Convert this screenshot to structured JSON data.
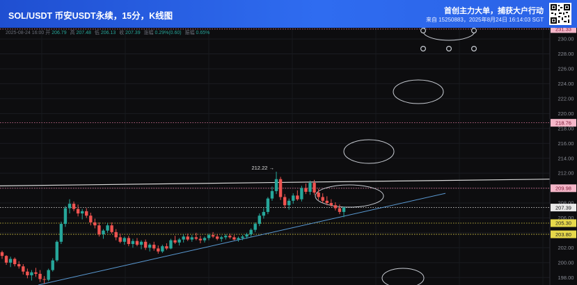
{
  "header": {
    "title": "SOL/USDT 币安USDT永续，15分，K线图",
    "slogan": "首创主力大单，捕获大户行动",
    "meta": "来自 15250883，2025年8月24日 16:14:03 SGT"
  },
  "ohlc_bar": {
    "datetime": "2025-08-24 16:00",
    "open_label": "开",
    "open": "206.79",
    "high_label": "高",
    "high": "207.48",
    "low_label": "低",
    "low": "206.13",
    "close_label": "收",
    "close": "207.39",
    "change_label": "涨幅",
    "change": "0.29%(0.60)",
    "amplitude_label": "振幅",
    "amplitude": "0.65%"
  },
  "colors": {
    "up": "#26a69a",
    "down": "#ef5350",
    "trendline": "#5b9bd5",
    "resistance": "#d9d9d9",
    "support": "#e6d84a",
    "alert": "#e57ca0",
    "current": "#cfcfcf"
  },
  "chart_data": {
    "type": "candlestick",
    "symbol": "SOL/USDT",
    "interval": "15m",
    "y_axis": {
      "min": 197,
      "max": 231.5,
      "position": "right",
      "ticks": [
        198.0,
        200.0,
        202.0,
        204.0,
        206.0,
        208.0,
        210.0,
        212.0,
        214.0,
        216.0,
        218.0,
        220.0,
        222.0,
        224.0,
        226.0,
        228.0,
        230.0
      ]
    },
    "grid": true,
    "price_tags": [
      {
        "label": "231.33",
        "value": 231.33,
        "style": "alert"
      },
      {
        "label": "218.76",
        "value": 218.76,
        "style": "alert"
      },
      {
        "label": "209.98",
        "value": 209.98,
        "style": "alert"
      },
      {
        "label": "207.39",
        "value": 207.39,
        "style": "current"
      },
      {
        "label": "205.30",
        "value": 205.3,
        "style": "support"
      },
      {
        "label": "203.80",
        "value": 203.8,
        "style": "support"
      }
    ],
    "annotation": {
      "label": "212.22 →",
      "value": 212.22
    },
    "candles": [
      [
        201.4,
        201.6,
        200.5,
        200.9
      ],
      [
        200.9,
        201.0,
        199.7,
        200.0
      ],
      [
        200.0,
        200.8,
        199.4,
        200.5
      ],
      [
        200.5,
        200.7,
        199.5,
        199.8
      ],
      [
        199.8,
        200.2,
        199.2,
        199.5
      ],
      [
        199.5,
        199.8,
        198.4,
        198.8
      ],
      [
        198.8,
        199.2,
        197.9,
        198.3
      ],
      [
        198.3,
        199.0,
        197.6,
        198.7
      ],
      [
        198.7,
        199.3,
        198.1,
        198.5
      ],
      [
        198.5,
        199.0,
        197.4,
        197.8
      ],
      [
        197.8,
        198.2,
        197.2,
        197.7
      ],
      [
        197.7,
        199.2,
        197.5,
        199.0
      ],
      [
        199.0,
        200.6,
        198.8,
        200.3
      ],
      [
        200.3,
        203.0,
        200.1,
        202.8
      ],
      [
        202.8,
        205.5,
        202.5,
        205.2
      ],
      [
        205.2,
        207.6,
        204.8,
        207.3
      ],
      [
        207.3,
        208.5,
        206.6,
        207.9
      ],
      [
        207.9,
        208.2,
        206.9,
        207.2
      ],
      [
        207.2,
        207.8,
        206.2,
        206.6
      ],
      [
        206.6,
        207.2,
        205.8,
        206.9
      ],
      [
        206.9,
        207.3,
        206.0,
        206.3
      ],
      [
        206.3,
        206.7,
        205.0,
        205.4
      ],
      [
        205.4,
        205.9,
        204.6,
        205.0
      ],
      [
        205.0,
        205.4,
        203.5,
        203.8
      ],
      [
        203.8,
        204.5,
        203.2,
        204.3
      ],
      [
        204.3,
        205.3,
        204.0,
        205.0
      ],
      [
        205.0,
        205.4,
        203.9,
        204.1
      ],
      [
        204.1,
        204.5,
        203.0,
        203.4
      ],
      [
        203.4,
        203.9,
        202.6,
        202.8
      ],
      [
        202.8,
        203.5,
        202.4,
        203.3
      ],
      [
        203.3,
        203.6,
        202.2,
        202.5
      ],
      [
        202.5,
        203.2,
        202.0,
        202.9
      ],
      [
        202.9,
        203.3,
        202.2,
        202.4
      ],
      [
        202.4,
        203.0,
        201.8,
        202.8
      ],
      [
        202.8,
        203.1,
        201.7,
        202.0
      ],
      [
        202.0,
        202.6,
        201.5,
        202.4
      ],
      [
        202.4,
        202.8,
        201.6,
        201.9
      ],
      [
        201.9,
        202.3,
        201.2,
        201.5
      ],
      [
        201.5,
        202.4,
        201.3,
        202.2
      ],
      [
        202.2,
        202.6,
        201.7,
        201.9
      ],
      [
        201.9,
        203.2,
        201.8,
        203.0
      ],
      [
        203.0,
        203.6,
        202.5,
        202.7
      ],
      [
        202.7,
        203.3,
        202.3,
        203.1
      ],
      [
        203.1,
        203.8,
        202.7,
        203.5
      ],
      [
        203.5,
        203.9,
        202.9,
        203.1
      ],
      [
        203.1,
        203.7,
        202.8,
        203.4
      ],
      [
        203.4,
        204.0,
        203.0,
        203.2
      ],
      [
        203.2,
        203.6,
        202.6,
        203.0
      ],
      [
        203.0,
        203.5,
        202.7,
        203.3
      ],
      [
        203.3,
        203.9,
        203.0,
        203.7
      ],
      [
        203.7,
        204.1,
        203.3,
        203.5
      ],
      [
        203.5,
        203.8,
        203.0,
        203.2
      ],
      [
        203.2,
        203.6,
        202.8,
        203.4
      ],
      [
        203.4,
        203.8,
        203.1,
        203.6
      ],
      [
        203.6,
        203.9,
        203.2,
        203.4
      ],
      [
        203.4,
        203.7,
        203.0,
        203.1
      ],
      [
        203.1,
        203.5,
        202.8,
        203.3
      ],
      [
        203.3,
        203.7,
        203.0,
        203.5
      ],
      [
        203.5,
        204.0,
        203.2,
        203.8
      ],
      [
        203.8,
        204.6,
        203.5,
        204.4
      ],
      [
        204.4,
        205.4,
        204.1,
        205.2
      ],
      [
        205.2,
        206.6,
        204.9,
        206.3
      ],
      [
        206.3,
        207.3,
        205.9,
        206.8
      ],
      [
        206.8,
        208.8,
        206.5,
        208.6
      ],
      [
        208.6,
        210.2,
        208.3,
        209.6
      ],
      [
        209.6,
        212.2,
        209.2,
        211.2
      ],
      [
        211.2,
        211.5,
        208.4,
        208.8
      ],
      [
        208.8,
        209.2,
        207.3,
        207.7
      ],
      [
        207.7,
        208.6,
        207.1,
        208.3
      ],
      [
        208.3,
        209.3,
        207.9,
        209.0
      ],
      [
        209.0,
        209.7,
        208.3,
        208.5
      ],
      [
        208.5,
        210.3,
        208.2,
        210.0
      ],
      [
        210.0,
        210.6,
        209.2,
        209.5
      ],
      [
        209.5,
        211.0,
        209.1,
        210.7
      ],
      [
        210.7,
        211.1,
        209.1,
        209.4
      ],
      [
        209.4,
        209.9,
        208.4,
        208.8
      ],
      [
        208.8,
        209.3,
        208.0,
        208.3
      ],
      [
        208.3,
        208.9,
        207.7,
        208.0
      ],
      [
        208.0,
        208.5,
        207.5,
        207.7
      ],
      [
        207.7,
        208.1,
        207.0,
        207.3
      ],
      [
        207.3,
        207.8,
        206.5,
        206.8
      ],
      [
        206.8,
        207.5,
        206.1,
        207.39
      ]
    ]
  }
}
